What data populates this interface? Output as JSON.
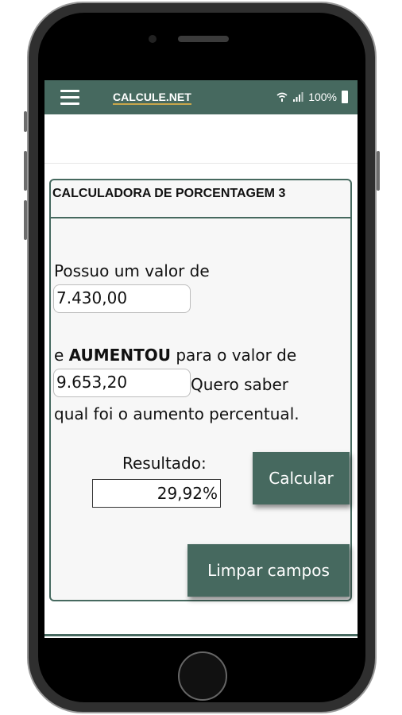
{
  "statusbar": {
    "brand": "CALCULE.NET",
    "battery": "100%"
  },
  "calculator": {
    "title": "CALCULADORA DE PORCENTAGEM 3",
    "label_initial": "Possuo um valor de",
    "value_initial": "7.430,00",
    "label_prefix": "e ",
    "label_bold": "AUMENTOU",
    "label_suffix": " para o valor de",
    "value_final": "9.653,20",
    "label_after": " Quero saber",
    "label_line3": "qual foi o aumento percentual.",
    "result_label": "Resultado:",
    "result_value": "29,92%",
    "calc_button": "Calcular",
    "clear_button": "Limpar campos"
  },
  "colors": {
    "accent": "#46695f",
    "brand_underline": "#c9a64b"
  },
  "icons": [
    "menu-icon",
    "wifi-icon",
    "signal-icon",
    "battery-icon"
  ]
}
